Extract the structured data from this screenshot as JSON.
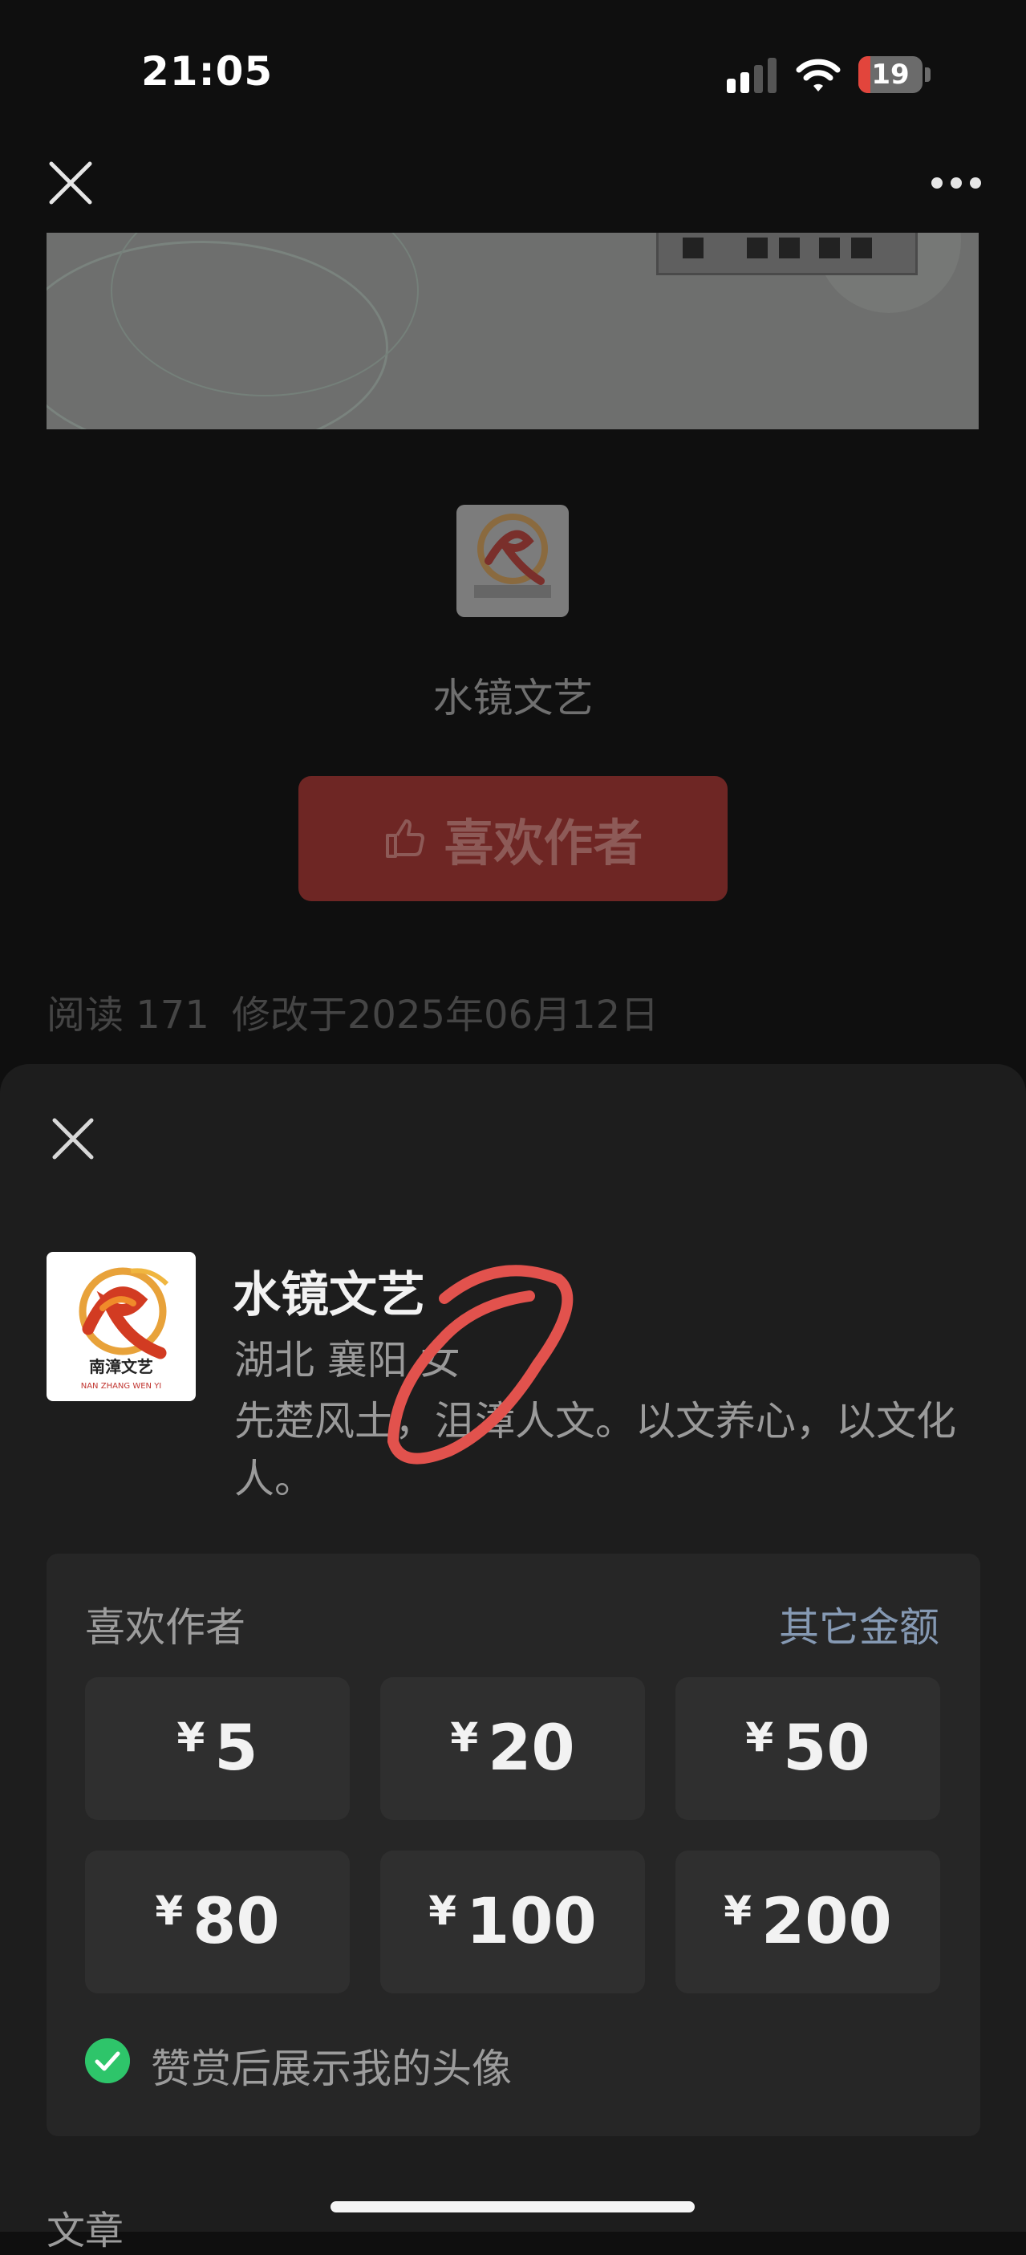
{
  "status_bar": {
    "time": "21:05",
    "battery_level": "19"
  },
  "article": {
    "account_name": "水镜文艺",
    "like_button_label": "喜欢作者",
    "read_label": "阅读 171",
    "modified_label": "修改于2025年06月12日"
  },
  "logo": {
    "main": "南漳文艺",
    "sub": "NAN ZHANG WEN YI"
  },
  "sheet": {
    "author_name": "水镜文艺",
    "location": "湖北 襄阳 女",
    "bio": "先楚风土，沮漳人文。以文养心，以文化人。",
    "panel_title": "喜欢作者",
    "other_amount_label": "其它金额",
    "currency": "¥",
    "amounts": [
      "5",
      "20",
      "50",
      "80",
      "100",
      "200"
    ],
    "show_avatar_label": "赞赏后展示我的头像",
    "section_label": "文章"
  },
  "colors": {
    "accent_red": "#c0342f",
    "link_blue": "#8599b3",
    "check_green": "#2ec56a",
    "annotation_red": "#e2524d"
  }
}
